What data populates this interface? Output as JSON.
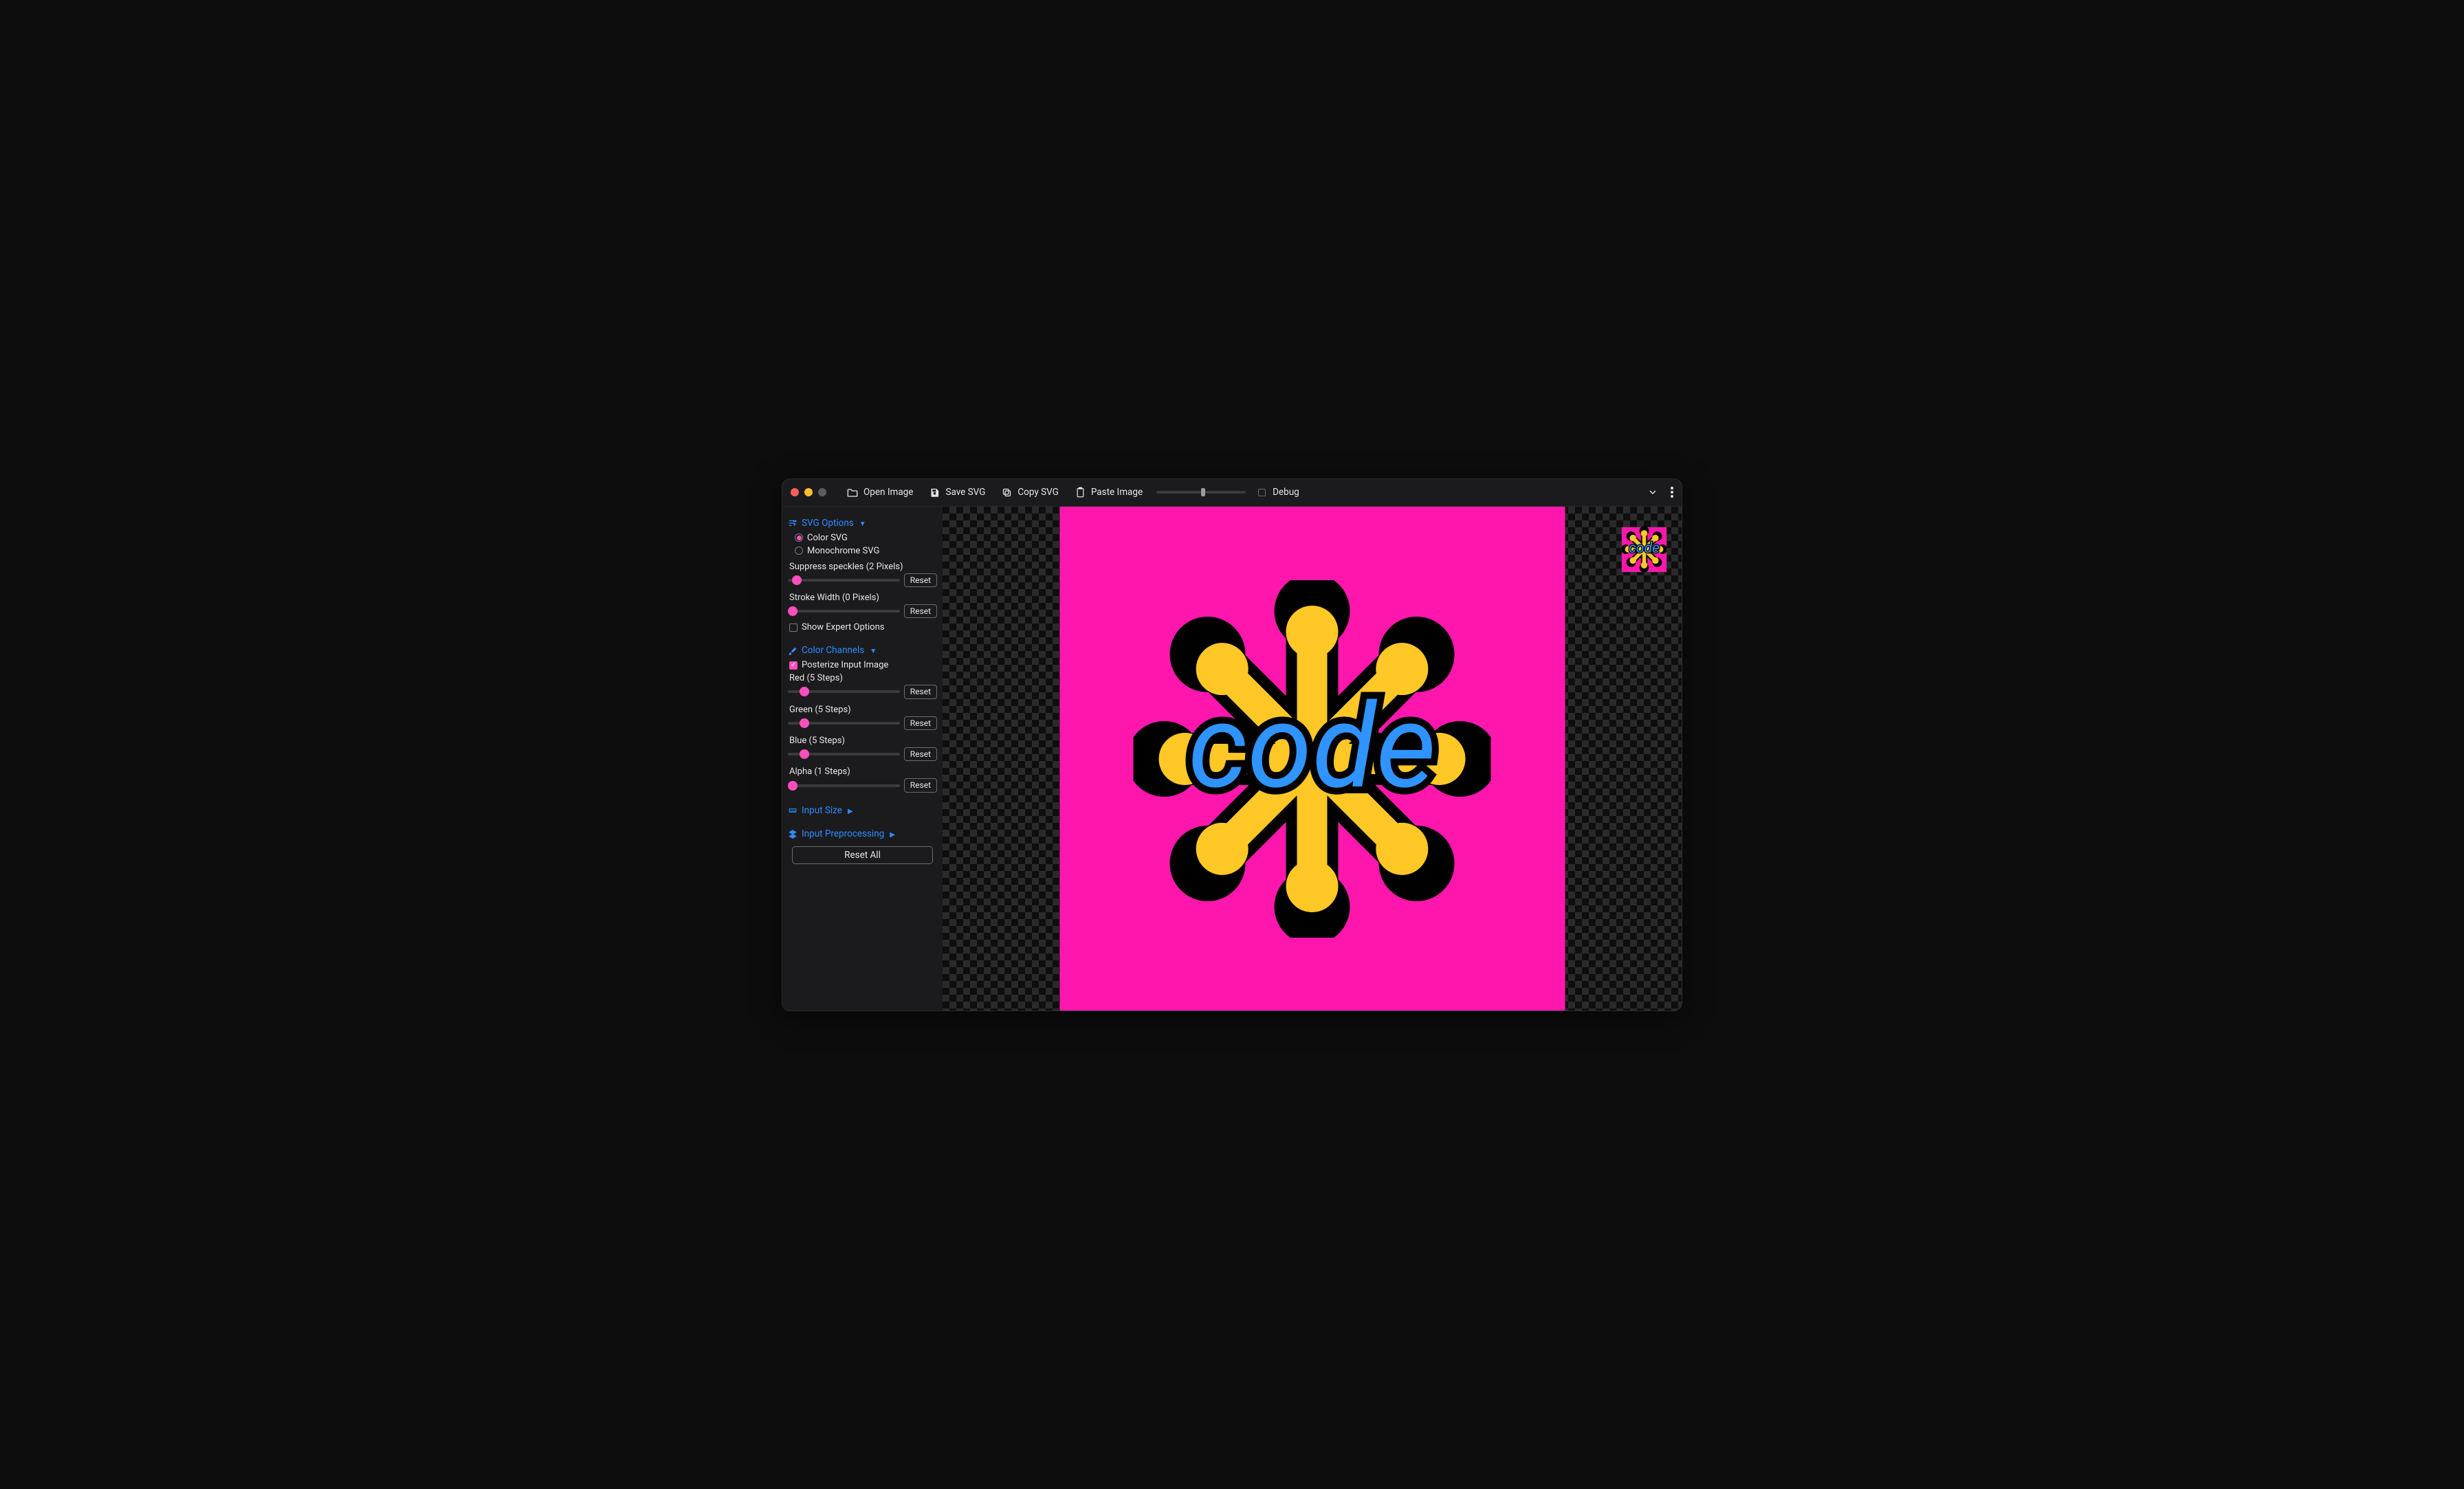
{
  "colors": {
    "accent": "#2f8cff",
    "pink": "#ff4fbd",
    "canvas_pink": "#ff17ad",
    "code_yellow": "#ffc826",
    "code_blue": "#2f94ff",
    "black": "#000000"
  },
  "toolbar": {
    "open_label": "Open Image",
    "save_label": "Save SVG",
    "copy_label": "Copy SVG",
    "paste_label": "Paste Image",
    "debug_label": "Debug",
    "debug_checked": false
  },
  "sidebar": {
    "svg_options": {
      "title": "SVG Options",
      "expanded": true,
      "radio_options": [
        {
          "label": "Color SVG",
          "checked": true
        },
        {
          "label": "Monochrome SVG",
          "checked": false
        }
      ],
      "suppress": {
        "label": "Suppress speckles (2 Pixels)",
        "value": 2,
        "min": 0,
        "max": 50,
        "reset": "Reset"
      },
      "stroke": {
        "label": "Stroke Width (0 Pixels)",
        "value": 0,
        "min": 0,
        "max": 50,
        "reset": "Reset"
      },
      "expert": {
        "label": "Show Expert Options",
        "checked": false
      }
    },
    "color_channels": {
      "title": "Color Channels",
      "expanded": true,
      "posterize": {
        "label": "Posterize Input Image",
        "checked": true
      },
      "red": {
        "label": "Red (5 Steps)",
        "value": 5,
        "min": 1,
        "max": 32,
        "reset": "Reset"
      },
      "green": {
        "label": "Green (5 Steps)",
        "value": 5,
        "min": 1,
        "max": 32,
        "reset": "Reset"
      },
      "blue": {
        "label": "Blue (5 Steps)",
        "value": 5,
        "min": 1,
        "max": 32,
        "reset": "Reset"
      },
      "alpha": {
        "label": "Alpha (1 Steps)",
        "value": 1,
        "min": 1,
        "max": 32,
        "reset": "Reset"
      }
    },
    "input_size": {
      "title": "Input Size",
      "expanded": false
    },
    "input_preprocessing": {
      "title": "Input Preprocessing",
      "expanded": false
    },
    "reset_all": "Reset All"
  },
  "canvas": {
    "image_text": "code"
  }
}
